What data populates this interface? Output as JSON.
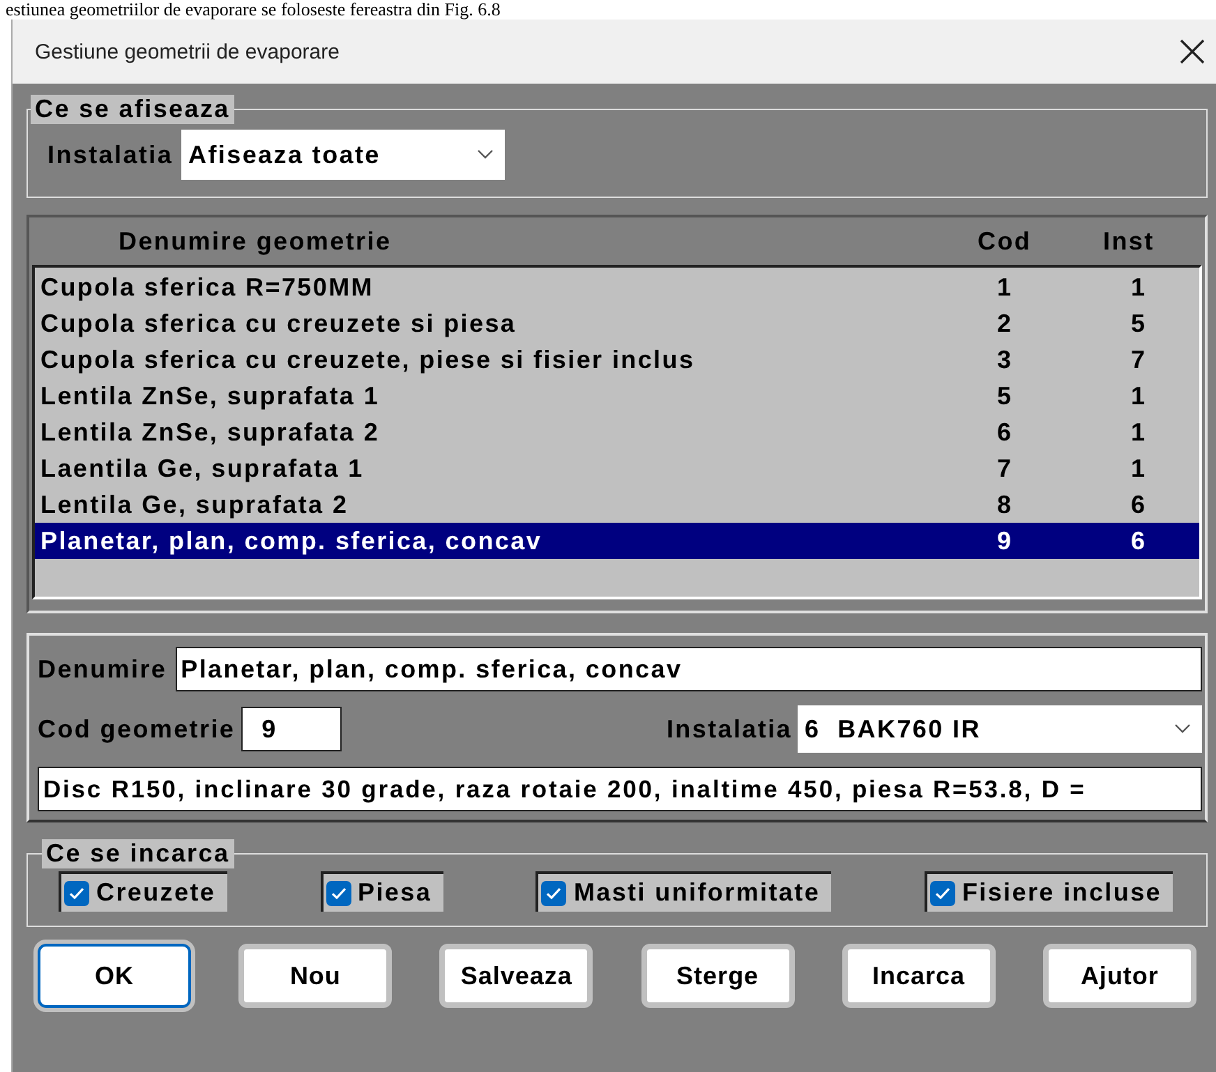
{
  "document_line": "estiunea geometriilor de evaporare se foloseste fereastra din Fig. 6.8",
  "window": {
    "title": "Gestiune geometrii de evaporare"
  },
  "display_group": {
    "title": "Ce se afiseaza",
    "installation_label": "Instalatia",
    "installation_value": "Afiseaza toate"
  },
  "geometry_table": {
    "columns": [
      "Denumire geometrie",
      "Cod",
      "Inst"
    ],
    "rows": [
      {
        "name": "Cupola sferica R=750MM",
        "cod": "1",
        "inst": "1",
        "selected": false
      },
      {
        "name": "Cupola sferica cu creuzete si piesa",
        "cod": "2",
        "inst": "5",
        "selected": false
      },
      {
        "name": "Cupola sferica cu creuzete, piese si fisier inclus",
        "cod": "3",
        "inst": "7",
        "selected": false
      },
      {
        "name": "Lentila ZnSe, suprafata 1",
        "cod": "5",
        "inst": "1",
        "selected": false
      },
      {
        "name": "Lentila ZnSe, suprafata 2",
        "cod": "6",
        "inst": "1",
        "selected": false
      },
      {
        "name": "Laentila Ge, suprafata 1",
        "cod": "7",
        "inst": "1",
        "selected": false
      },
      {
        "name": "Lentila Ge, suprafata 2",
        "cod": "8",
        "inst": "6",
        "selected": false
      },
      {
        "name": "Planetar, plan, comp. sferica, concav",
        "cod": "9",
        "inst": "6",
        "selected": true
      }
    ]
  },
  "details": {
    "name_label": "Denumire",
    "name_value": "Planetar, plan, comp. sferica, concav",
    "code_label": "Cod geometrie",
    "code_value": "9",
    "installation_label": "Instalatia",
    "installation_value": "6  BAK760 IR",
    "description_value": "Disc R150, inclinare 30 grade, raza rotaie 200, inaltime 450, piesa R=53.8, D ="
  },
  "load_group": {
    "title": "Ce se incarca",
    "options": [
      {
        "label": "Creuzete",
        "checked": true
      },
      {
        "label": "Piesa",
        "checked": true
      },
      {
        "label": "Masti uniformitate",
        "checked": true
      },
      {
        "label": "Fisiere incluse",
        "checked": true
      }
    ]
  },
  "buttons": [
    {
      "label": "OK",
      "default": true
    },
    {
      "label": "Nou",
      "default": false
    },
    {
      "label": "Salveaza",
      "default": false
    },
    {
      "label": "Sterge",
      "default": false
    },
    {
      "label": "Incarca",
      "default": false
    },
    {
      "label": "Ajutor",
      "default": false
    }
  ]
}
